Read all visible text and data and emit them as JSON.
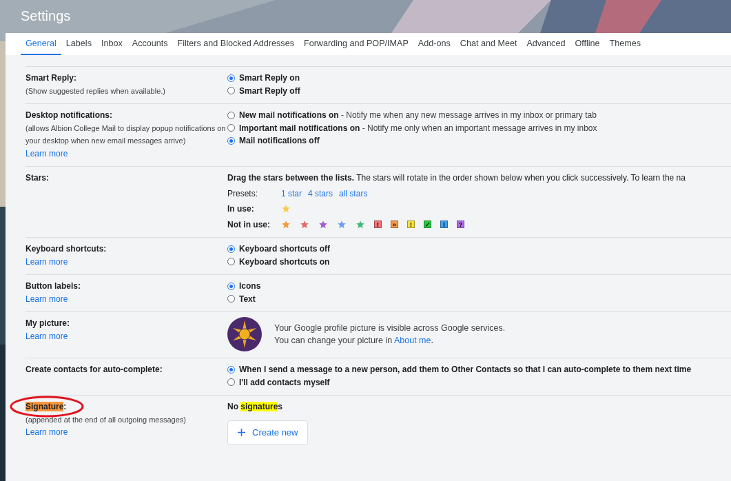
{
  "title": "Settings",
  "tabs": [
    {
      "label": "General",
      "selected": true
    },
    {
      "label": "Labels",
      "selected": false
    },
    {
      "label": "Inbox",
      "selected": false
    },
    {
      "label": "Accounts",
      "selected": false
    },
    {
      "label": "Filters and Blocked Addresses",
      "selected": false
    },
    {
      "label": "Forwarding and POP/IMAP",
      "selected": false
    },
    {
      "label": "Add-ons",
      "selected": false
    },
    {
      "label": "Chat and Meet",
      "selected": false
    },
    {
      "label": "Advanced",
      "selected": false
    },
    {
      "label": "Offline",
      "selected": false
    },
    {
      "label": "Themes",
      "selected": false
    }
  ],
  "sections": [
    {
      "kind": "radio",
      "label": "Smart Reply:",
      "note": "(Show suggested replies when available.)",
      "options": [
        {
          "label": "Smart Reply on",
          "selected": true
        },
        {
          "label": "Smart Reply off",
          "selected": false
        }
      ]
    },
    {
      "kind": "radio",
      "label": "Desktop notifications:",
      "note": "(allows Albion College Mail to display popup notifications on your desktop when new email messages arrive)",
      "link": "Learn more",
      "options": [
        {
          "label": "New mail notifications on",
          "description": " - Notify me when any new message arrives in my inbox or primary tab",
          "selected": false
        },
        {
          "label": "Important mail notifications on",
          "description": " - Notify me only when an important message arrives in my inbox",
          "selected": false
        },
        {
          "label": "Mail notifications off",
          "selected": true
        }
      ]
    },
    {
      "kind": "stars",
      "label": "Stars:",
      "intro": "**Drag the stars between the lists.**  The stars will rotate in the order shown below when you click successively. To learn the na",
      "presets_label": "Presets:",
      "presets": [
        "1 star",
        "4 stars",
        "all stars"
      ],
      "in_use_label": "In use:",
      "in_use": [
        {
          "kind": "star",
          "color": "#f7cb4d"
        }
      ],
      "not_in_use_label": "Not in use:",
      "not_in_use": [
        {
          "kind": "star",
          "color": "#fa983a"
        },
        {
          "kind": "star",
          "color": "#e06c66"
        },
        {
          "kind": "star",
          "color": "#a45ad0"
        },
        {
          "kind": "star",
          "color": "#6e9ef7"
        },
        {
          "kind": "star",
          "color": "#44b77b"
        },
        {
          "kind": "box",
          "color": "#f5737b",
          "glyph": "!"
        },
        {
          "kind": "box",
          "color": "#f59a45",
          "glyph": "»"
        },
        {
          "kind": "box",
          "color": "#f7e03a",
          "glyph": "!"
        },
        {
          "kind": "box",
          "color": "#28c93c",
          "glyph": "✓"
        },
        {
          "kind": "box",
          "color": "#3ea2f0",
          "glyph": "i"
        },
        {
          "kind": "box",
          "color": "#b769f5",
          "glyph": "?"
        }
      ]
    },
    {
      "kind": "radio",
      "label": "Keyboard shortcuts:",
      "link": "Learn more",
      "options": [
        {
          "label": "Keyboard shortcuts off",
          "selected": true
        },
        {
          "label": "Keyboard shortcuts on",
          "selected": false
        }
      ]
    },
    {
      "kind": "radio",
      "label": "Button labels:",
      "link": "Learn more",
      "options": [
        {
          "label": "Icons",
          "selected": true
        },
        {
          "label": "Text",
          "selected": false
        }
      ]
    },
    {
      "kind": "picture",
      "label": "My picture:",
      "link": "Learn more",
      "line_1": "Your Google profile picture is visible across Google services.",
      "line_2": "You can change your picture in ",
      "line_2_link": "About me",
      "line_2_end": "."
    },
    {
      "kind": "radio",
      "label": "Create contacts for auto-complete:",
      "options": [
        {
          "label": "When I send a message to a new person, add them to Other Contacts so that I can auto-complete to them next time",
          "selected": true
        },
        {
          "label": "I'll add contacts myself",
          "selected": false
        }
      ]
    },
    {
      "kind": "signature",
      "label_parts": [
        {
          "text": "Signature",
          "color": "#f7963c"
        },
        {
          "text": ":"
        }
      ],
      "circled": true,
      "note": "(appended at the end of all outgoing messages)",
      "link": "Learn more",
      "status_parts": [
        {
          "text": "No "
        },
        {
          "text": "signature",
          "color": "#ffff00"
        },
        {
          "text": "s"
        }
      ],
      "button": "Create new"
    }
  ]
}
